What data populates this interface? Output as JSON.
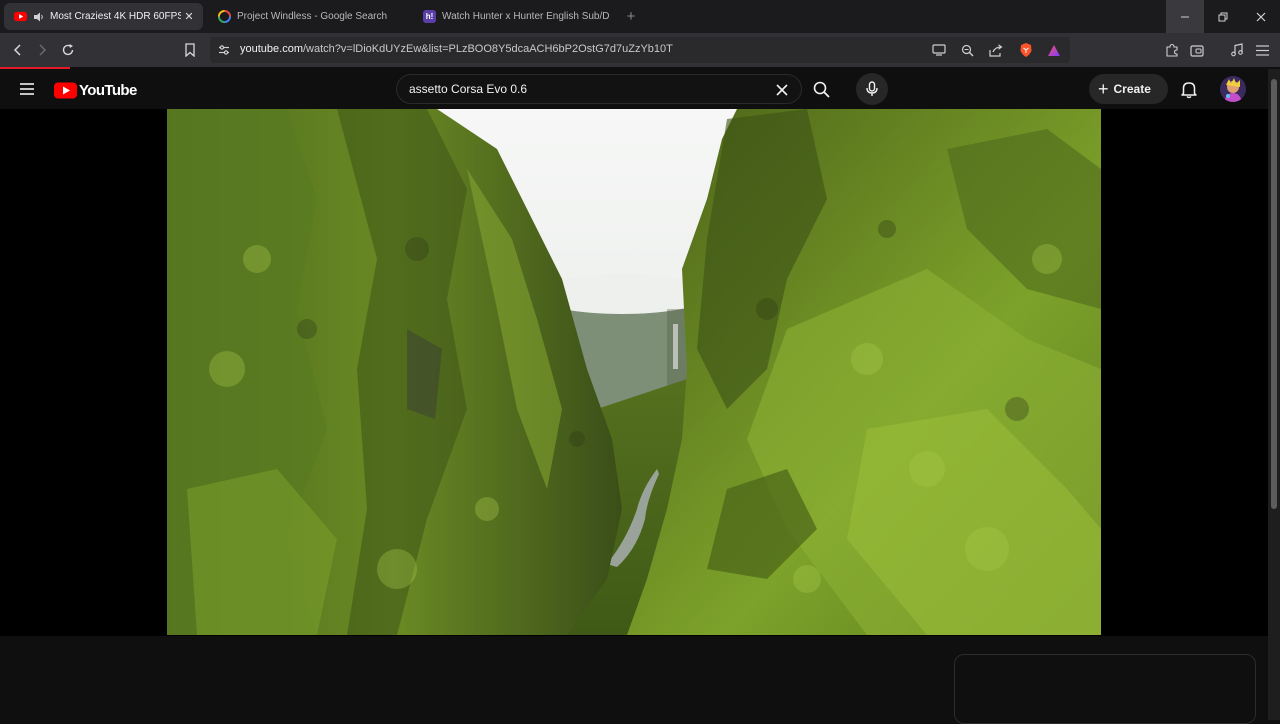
{
  "browser": {
    "tabs": [
      {
        "title": "Most Craziest 4K HDR 60FPS ",
        "active": true,
        "favicon": "youtube-icon",
        "audio": true
      },
      {
        "title": "Project Windless - Google Search",
        "active": false,
        "favicon": "google-icon"
      },
      {
        "title": "Watch Hunter x Hunter English Sub/D",
        "active": false,
        "favicon": "hianime-icon"
      }
    ],
    "hianime_favicon_text": "h!",
    "url_host": "youtube.com",
    "url_rest": "/watch?v=lDioKdUYzEw&list=PLzBOO8Y5dcaACH6bP2OstG7d7uZzYb10T"
  },
  "youtube": {
    "logo_text": "YouTube",
    "search_value": "assetto Corsa Evo 0.6",
    "create_label": "Create"
  },
  "colors": {
    "youtube_red": "#ff0000",
    "accent_bar": "#e11b2a",
    "brave_orange": "#fb542b"
  }
}
